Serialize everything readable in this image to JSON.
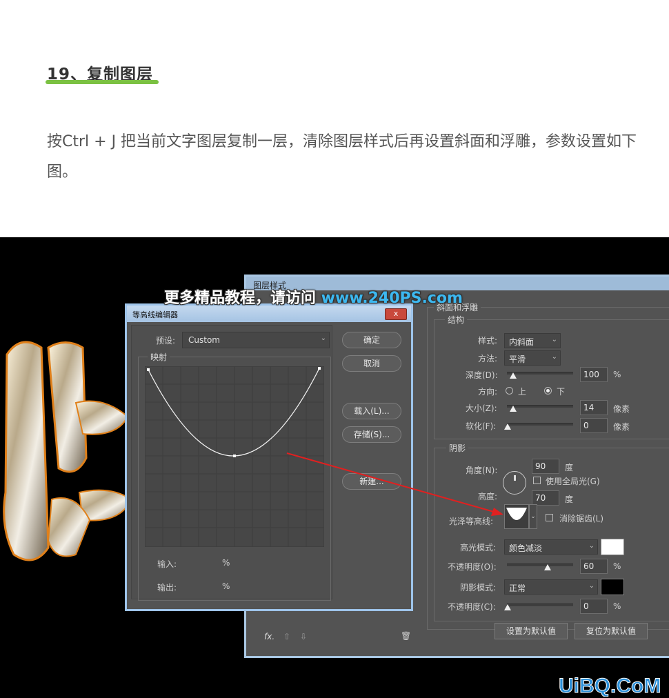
{
  "article": {
    "heading": "19、复制图层",
    "paragraph": "按Ctrl + J 把当前文字图层复制一层，清除图层样式后再设置斜面和浮雕，参数设置如下图。"
  },
  "watermark": {
    "prefix": "更多精品教程，请访问 ",
    "url": "www.240PS.com"
  },
  "layer_style": {
    "title": "图层样式",
    "section_title": "斜面和浮雕",
    "structure": {
      "title": "结构",
      "style_label": "样式:",
      "style_value": "内斜面",
      "method_label": "方法:",
      "method_value": "平滑",
      "depth_label": "深度(D):",
      "depth_value": "100",
      "depth_unit": "%",
      "direction_label": "方向:",
      "direction_up": "上",
      "direction_down": "下",
      "size_label": "大小(Z):",
      "size_value": "14",
      "size_unit": "像素",
      "soften_label": "软化(F):",
      "soften_value": "0",
      "soften_unit": "像素"
    },
    "shading": {
      "title": "阴影",
      "angle_label": "角度(N):",
      "angle_value": "90",
      "angle_unit": "度",
      "global_light_label": "使用全局光(G)",
      "altitude_label": "高度:",
      "altitude_value": "70",
      "altitude_unit": "度",
      "gloss_label": "光泽等高线:",
      "antialias_label": "消除锯齿(L)",
      "highlight_mode_label": "高光模式:",
      "highlight_mode_value": "颜色减淡",
      "highlight_opacity_label": "不透明度(O):",
      "highlight_opacity_value": "60",
      "highlight_opacity_unit": "%",
      "shadow_mode_label": "阴影模式:",
      "shadow_mode_value": "正常",
      "shadow_opacity_label": "不透明度(C):",
      "shadow_opacity_value": "0",
      "shadow_opacity_unit": "%",
      "highlight_color": "#ffffff",
      "shadow_color": "#000000"
    },
    "buttons": {
      "set_default": "设置为默认值",
      "reset_default": "复位为默认值"
    },
    "footer": {
      "fx": "fx."
    }
  },
  "contour_editor": {
    "title": "等高线编辑器",
    "close": "x",
    "preset_label": "预设:",
    "preset_value": "Custom",
    "mapping_label": "映射",
    "input_label": "输入:",
    "input_unit": "%",
    "output_label": "输出:",
    "output_unit": "%",
    "buttons": {
      "ok": "确定",
      "cancel": "取消",
      "load": "载入(L)...",
      "save": "存储(S)...",
      "new": "新建..."
    }
  },
  "site_logo": "UiBQ.CoM"
}
